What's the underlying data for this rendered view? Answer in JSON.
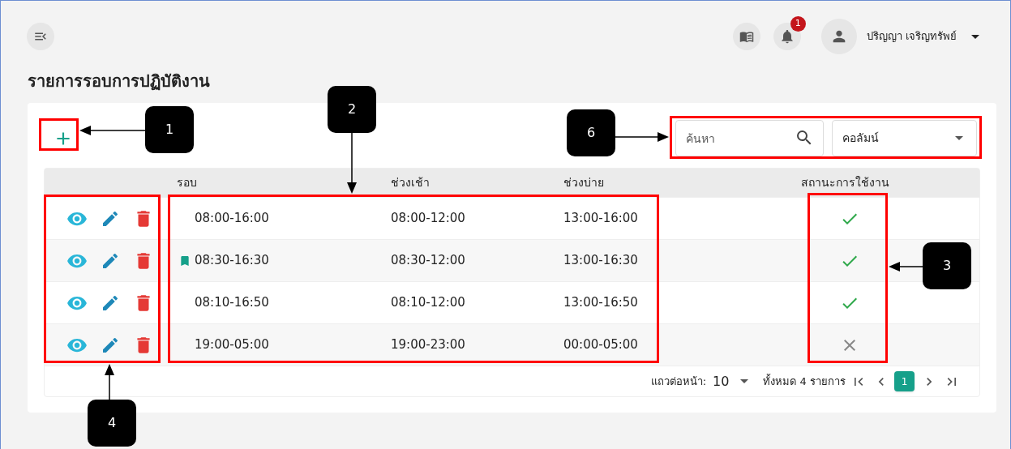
{
  "header": {
    "notification_count": "1",
    "user_name": "ปริญญา เจริญทรัพย์"
  },
  "page_title": "รายการรอบการปฏิบัติงาน",
  "search": {
    "placeholder": "ค้นหา"
  },
  "column_select": {
    "value": "คอลัมน์"
  },
  "table": {
    "columns": [
      "รอบ",
      "ช่วงเช้า",
      "ช่วงบ่าย",
      "สถานะการใช้งาน"
    ],
    "rows": [
      {
        "shift": "08:00-16:00",
        "bookmarked": false,
        "morning": "08:00-12:00",
        "afternoon": "13:00-16:00",
        "active": true
      },
      {
        "shift": "08:30-16:30",
        "bookmarked": true,
        "morning": "08:30-12:00",
        "afternoon": "13:00-16:30",
        "active": true
      },
      {
        "shift": "08:10-16:50",
        "bookmarked": false,
        "morning": "08:10-12:00",
        "afternoon": "13:00-16:50",
        "active": true
      },
      {
        "shift": "19:00-05:00",
        "bookmarked": false,
        "morning": "19:00-23:00",
        "afternoon": "00:00-05:00",
        "active": false
      }
    ]
  },
  "pagination": {
    "rows_per_page_label": "แถวต่อหน้า:",
    "rows_per_page": "10",
    "total": "ทั้งหมด 4 รายการ",
    "pages": [
      {
        "label": "1",
        "selected": true
      }
    ]
  },
  "annotations": [
    {
      "label": "1"
    },
    {
      "label": "2"
    },
    {
      "label": "3"
    },
    {
      "label": "4"
    },
    {
      "label": "6"
    }
  ]
}
